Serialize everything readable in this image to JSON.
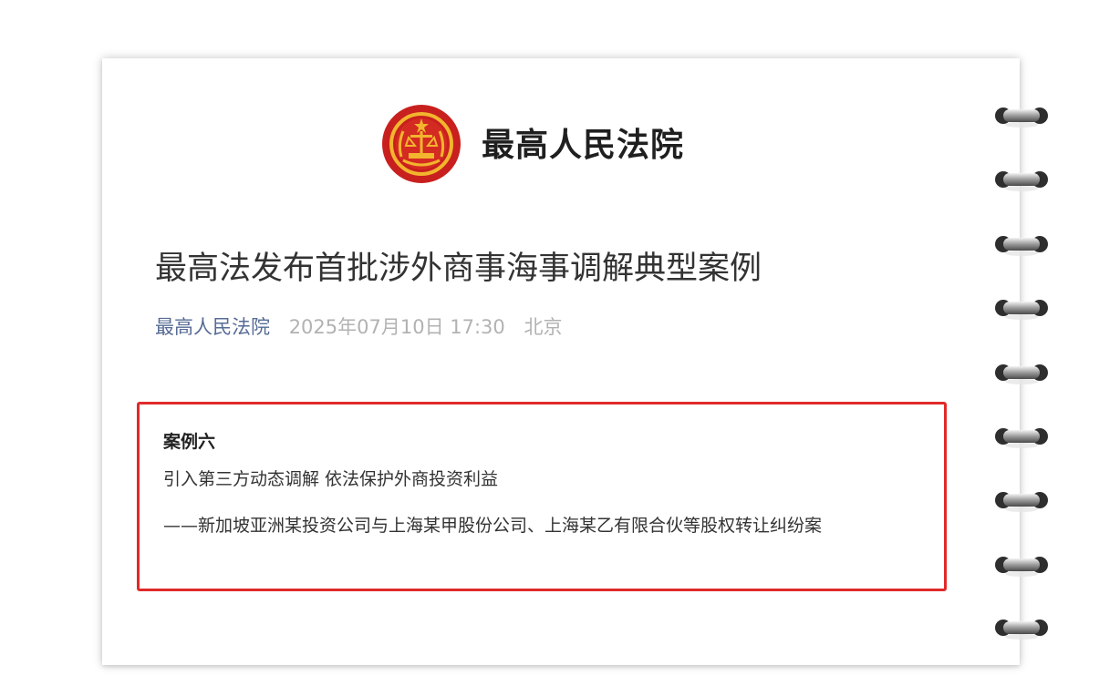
{
  "header": {
    "org_name": "最高人民法院",
    "emblem_icon": "court-emblem-icon"
  },
  "article": {
    "title": "最高法发布首批涉外商事海事调解典型案例",
    "source": "最高人民法院",
    "date": "2025年07月10日 17:30",
    "location": "北京"
  },
  "case": {
    "number": "案例六",
    "title": "引入第三方动态调解 依法保护外商投资利益",
    "subtitle": "——新加坡亚洲某投资公司与上海某甲股份公司、上海某乙有限合伙等股权转让纠纷案"
  },
  "colors": {
    "highlight_border": "#e02a2a",
    "emblem_red": "#c8201e",
    "emblem_gold": "#f2b52d",
    "source_link": "#576b95",
    "meta_gray": "#b2b2b2"
  },
  "decor": {
    "binding_icon": "spiral-binding-icon"
  }
}
